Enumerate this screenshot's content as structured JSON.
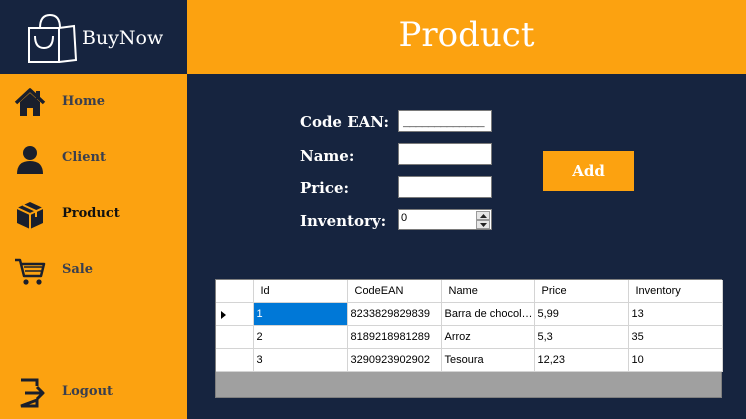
{
  "app": {
    "name": "BuyNow"
  },
  "header": {
    "title": "Product"
  },
  "sidebar": {
    "items": [
      {
        "label": "Home",
        "icon": "home-icon"
      },
      {
        "label": "Client",
        "icon": "user-icon"
      },
      {
        "label": "Product",
        "icon": "box-icon",
        "active": true
      },
      {
        "label": "Sale",
        "icon": "cart-icon"
      }
    ],
    "logout": {
      "label": "Logout",
      "icon": "logout-icon"
    }
  },
  "form": {
    "code_ean_label": "Code EAN:",
    "code_ean_value": "_____________",
    "name_label": "Name:",
    "name_value": "",
    "price_label": "Price:",
    "price_value": "",
    "inventory_label": "Inventory:",
    "inventory_value": "0",
    "add_label": "Add"
  },
  "grid": {
    "columns": [
      "Id",
      "CodeEAN",
      "Name",
      "Price",
      "Inventory"
    ],
    "rows": [
      [
        "1",
        "8233829829839",
        "Barra de chocolate",
        "5,99",
        "13"
      ],
      [
        "2",
        "8189218981289",
        "Arroz",
        "5,3",
        "35"
      ],
      [
        "3",
        "3290923902902",
        "Tesoura",
        "12,23",
        "10"
      ]
    ]
  },
  "colors": {
    "accent": "#fca210",
    "navy": "#16243f",
    "selection": "#0078d7"
  }
}
